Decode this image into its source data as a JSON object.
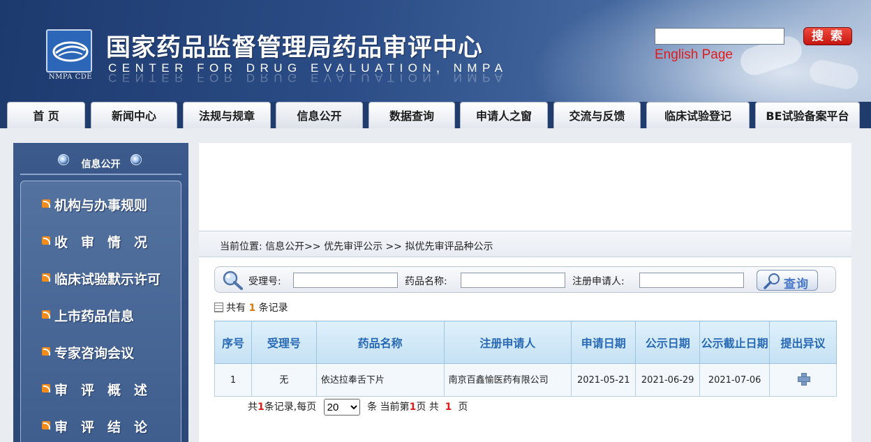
{
  "header": {
    "title": "国家药品监督管理局药品审评中心",
    "subtitle": "CENTER FOR DRUG EVALUATION, NMPA",
    "logo_caption": "NMPA CDE",
    "search_button": "搜 索",
    "english_link": "English Page"
  },
  "nav": {
    "tabs": [
      {
        "label": "首 页"
      },
      {
        "label": "新闻中心"
      },
      {
        "label": "法规与规章"
      },
      {
        "label": "信息公开"
      },
      {
        "label": "数据查询"
      },
      {
        "label": "申请人之窗"
      },
      {
        "label": "交流与反馈"
      },
      {
        "label": "临床试验登记"
      },
      {
        "label": "BE试验备案平台"
      }
    ],
    "active": "信息公开"
  },
  "sidebar": {
    "title": "信息公开",
    "items": [
      {
        "label": "机构与办事规则"
      },
      {
        "label": "收　审　情　况"
      },
      {
        "label": "临床试验默示许可"
      },
      {
        "label": "上市药品信息"
      },
      {
        "label": "专家咨询会议"
      },
      {
        "label": "审　评　概　述"
      },
      {
        "label": "审　评　结　论"
      }
    ]
  },
  "breadcrumb": "当前位置: 信息公开>> 优先审评公示 >> 拟优先审评品种公示",
  "query": {
    "accept_label": "受理号:",
    "drug_label": "药品名称:",
    "applicant_label": "注册申请人:",
    "accept_value": "",
    "drug_value": "",
    "applicant_value": "",
    "button": "查询"
  },
  "record_count": {
    "prefix": "共有",
    "count": "1",
    "suffix": "条记录"
  },
  "table": {
    "headers": [
      "序号",
      "受理号",
      "药品名称",
      "注册申请人",
      "申请日期",
      "公示日期",
      "公示截止日期",
      "提出异议"
    ],
    "rows": [
      {
        "index": "1",
        "accept_no": "无",
        "drug": "依达拉奉舌下片",
        "applicant": "南京百鑫愉医药有限公司",
        "apply_date": "2021-05-21",
        "publish_date": "2021-06-29",
        "deadline": "2021-07-06"
      }
    ]
  },
  "pager": {
    "t1": "共",
    "total": "1",
    "t2": "条记录,每页",
    "per_page": "20",
    "t3": "条 当前第",
    "current": "1",
    "t4": "页 共",
    "pages": "1",
    "t5": "页"
  },
  "colors": {
    "header_blue": "#2b4c86",
    "nav_bg": "#1f3c6d",
    "table_header_text": "#2769b4",
    "accent_red": "#e01b1b",
    "count_orange": "#e07a0a"
  }
}
